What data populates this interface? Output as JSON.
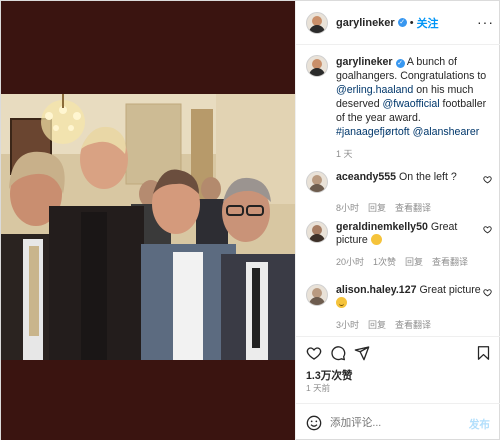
{
  "post": {
    "username": "garylineker",
    "follow_label": "关注",
    "more_icon": "more-horizontal-icon",
    "caption": {
      "username": "garylineker",
      "text_1": " A bunch of goalhangers. Congratulations to ",
      "mention_1": "@erling.haaland",
      "text_2": " on his much deserved ",
      "mention_2": "@fwaofficial",
      "text_3": " footballer of the year award. ",
      "hashtag": "#janaagefjørtoft",
      "text_4": " ",
      "mention_3": "@alanshearer",
      "time": "1 天"
    },
    "comments": [
      {
        "username": "aceandy555",
        "text": "On the left ?",
        "time": "8小时",
        "reply": "回复",
        "translate": "查看翻译"
      },
      {
        "username": "geraldinemkelly50",
        "text": "Great picture",
        "time": "20小时",
        "likes": "1次赞",
        "reply": "回复",
        "translate": "查看翻译"
      },
      {
        "username": "alison.haley.127",
        "text": "Great picture",
        "time": "3小时",
        "reply": "回复",
        "translate": "查看翻译"
      }
    ],
    "likes": "1.3万次赞",
    "posted": "1 天前",
    "comment_placeholder": "添加评论...",
    "post_label": "发布"
  },
  "colors": {
    "background_media": "#3a1410",
    "link": "#00376b",
    "follow": "#0095f6",
    "verified": "#3897f0",
    "muted": "#8e8e8e"
  }
}
